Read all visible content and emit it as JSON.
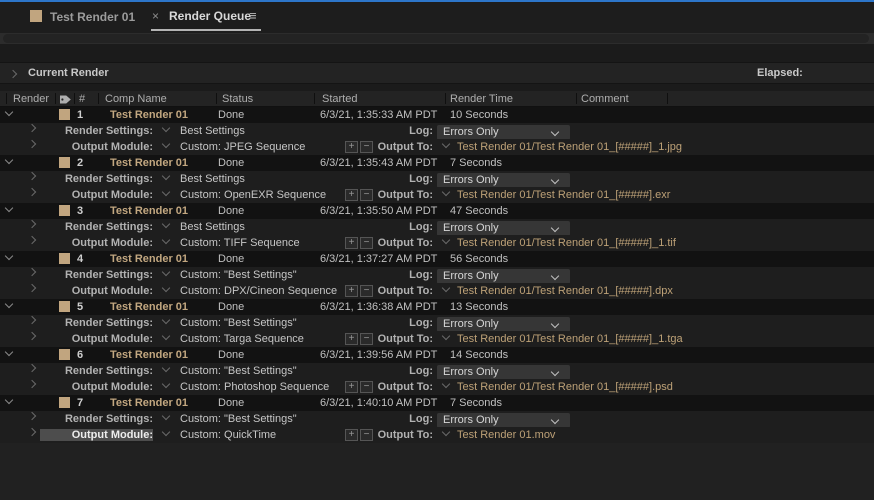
{
  "tab_bar": {
    "tabs": [
      {
        "label": "Test Render 01"
      },
      {
        "label": "Render Queue"
      }
    ],
    "close_glyph": "×",
    "menu_glyph": "≡"
  },
  "current_render": {
    "title": "Current Render",
    "elapsed_label": "Elapsed:"
  },
  "table": {
    "columns": [
      "Render",
      "#",
      "Comp Name",
      "Status",
      "Started",
      "Render Time",
      "Comment"
    ]
  },
  "row_labels": {
    "render_settings": "Render Settings:",
    "output_module": "Output Module:",
    "log": "Log:",
    "output_to": "Output To:"
  },
  "items": [
    {
      "num": "1",
      "comp": "Test Render 01",
      "status": "Done",
      "started": "6/3/21, 1:35:33 AM PDT",
      "render_time": "10 Seconds",
      "render_settings": "Best Settings",
      "output_module": "Custom: JPEG Sequence",
      "log": "Errors Only",
      "output_to": "Test Render 01/Test Render 01_[#####]_1.jpg"
    },
    {
      "num": "2",
      "comp": "Test Render 01",
      "status": "Done",
      "started": "6/3/21, 1:35:43 AM PDT",
      "render_time": "7 Seconds",
      "render_settings": "Best Settings",
      "output_module": "Custom: OpenEXR Sequence",
      "log": "Errors Only",
      "output_to": "Test Render 01/Test Render 01_[#####].exr"
    },
    {
      "num": "3",
      "comp": "Test Render 01",
      "status": "Done",
      "started": "6/3/21, 1:35:50 AM PDT",
      "render_time": "47 Seconds",
      "render_settings": "Best Settings",
      "output_module": "Custom: TIFF Sequence",
      "log": "Errors Only",
      "output_to": "Test Render 01/Test Render 01_[#####]_1.tif"
    },
    {
      "num": "4",
      "comp": "Test Render 01",
      "status": "Done",
      "started": "6/3/21, 1:37:27 AM PDT",
      "render_time": "56 Seconds",
      "render_settings": "Custom: \"Best Settings\"",
      "output_module": "Custom: DPX/Cineon Sequence",
      "log": "Errors Only",
      "output_to": "Test Render 01/Test Render 01_[#####].dpx"
    },
    {
      "num": "5",
      "comp": "Test Render 01",
      "status": "Done",
      "started": "6/3/21, 1:36:38 AM PDT",
      "render_time": "13 Seconds",
      "render_settings": "Custom: \"Best Settings\"",
      "output_module": "Custom: Targa Sequence",
      "log": "Errors Only",
      "output_to": "Test Render 01/Test Render 01_[#####]_1.tga"
    },
    {
      "num": "6",
      "comp": "Test Render 01",
      "status": "Done",
      "started": "6/3/21, 1:39:56 AM PDT",
      "render_time": "14 Seconds",
      "render_settings": "Custom: \"Best Settings\"",
      "output_module": "Custom: Photoshop Sequence",
      "log": "Errors Only",
      "output_to": "Test Render 01/Test Render 01_[#####].psd"
    },
    {
      "num": "7",
      "comp": "Test Render 01",
      "status": "Done",
      "started": "6/3/21, 1:40:10 AM PDT",
      "render_time": "7 Seconds",
      "render_settings": "Custom: \"Best Settings\"",
      "output_module": "Custom: QuickTime",
      "log": "Errors Only",
      "output_to": "Test Render 01.mov",
      "om_highlighted": true
    }
  ],
  "colors": {
    "accent_blue": "#2d76c9",
    "comp_name": "#c2a780",
    "output_path": "#bda177",
    "comp_swatch": "#c1a57f",
    "panel_bg": "#1d1d1d",
    "main_row_bg": "#121212",
    "sub_row_bg": "#1e1e1e"
  }
}
